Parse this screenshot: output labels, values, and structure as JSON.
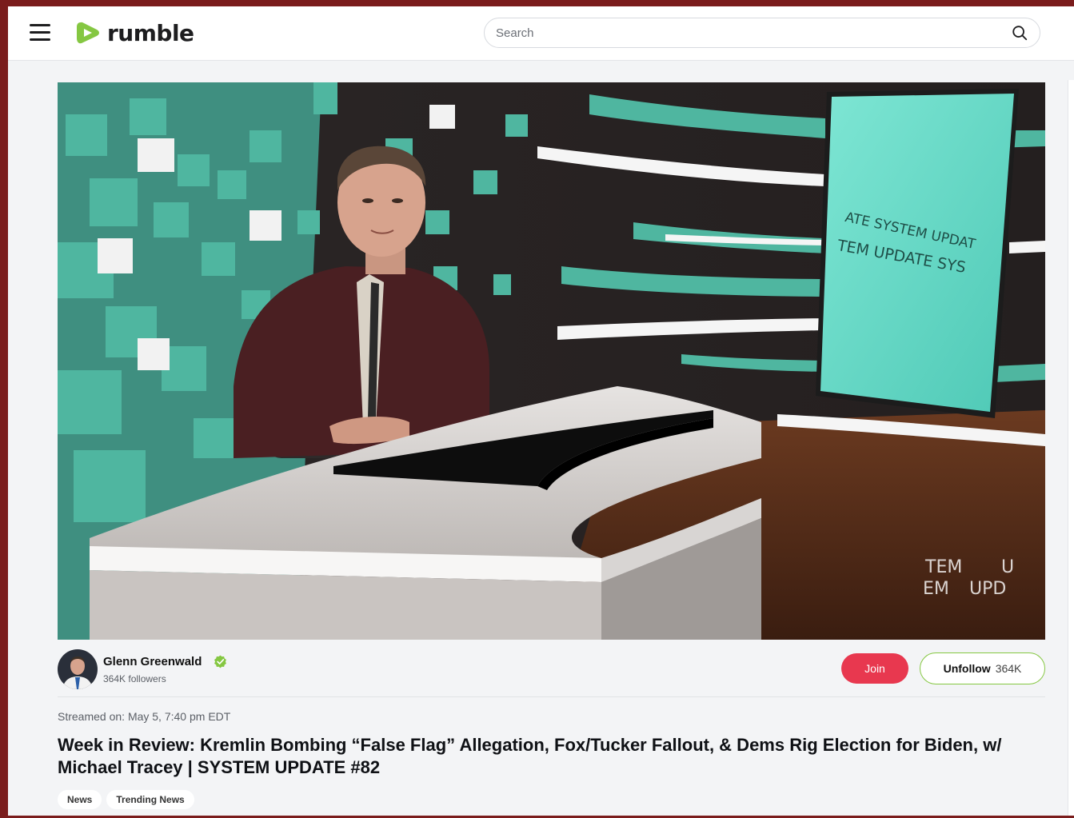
{
  "header": {
    "logo_text": "rumble",
    "search_placeholder": "Search",
    "menu_icon": "hamburger-menu-icon",
    "search_icon": "search-icon"
  },
  "video": {
    "screen_text_1": "ATE SYSTEM UPDAT",
    "screen_text_2": "TEM UPDATE SYS",
    "watermark_1": "TEM",
    "watermark_2": "U",
    "watermark_3": "EM",
    "watermark_4": "UPD"
  },
  "channel": {
    "name": "Glenn Greenwald",
    "followers": "364K followers",
    "join_label": "Join",
    "unfollow_label": "Unfollow",
    "unfollow_count": "364K",
    "verified_color": "#85c742"
  },
  "meta": {
    "streamed": "Streamed on: May 5, 7:40 pm EDT"
  },
  "title": "Week in Review: Kremlin Bombing “False Flag” Allegation, Fox/Tucker Fallout, & Dems Rig Election for Biden, w/ Michael Tracey | SYSTEM UPDATE #82",
  "tags": [
    "News",
    "Trending News"
  ],
  "colors": {
    "brand_green": "#85c742",
    "join_red": "#e8384f",
    "frame_border": "#7a1c1c",
    "studio_teal": "#4fb6a0"
  }
}
